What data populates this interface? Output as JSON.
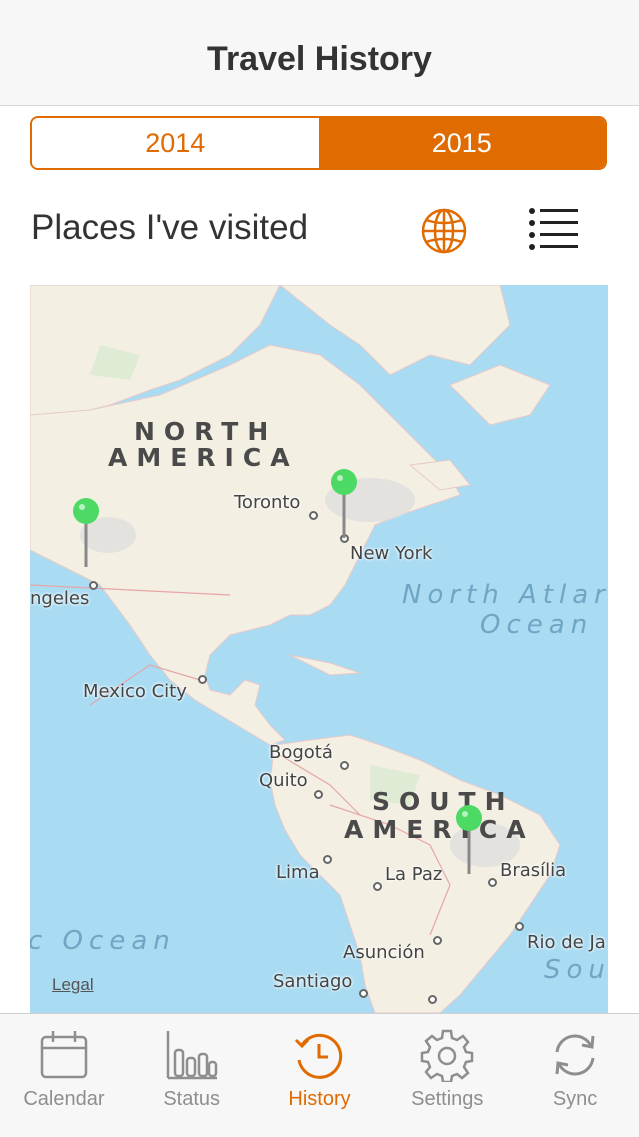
{
  "nav": {
    "title": "Travel History"
  },
  "segments": [
    {
      "label": "2014",
      "selected": false
    },
    {
      "label": "2015",
      "selected": true
    }
  ],
  "section": {
    "title": "Places I've visited",
    "globe_icon": "globe-icon",
    "list_icon": "list-icon"
  },
  "map": {
    "continents": {
      "north_america_1": "NORTH",
      "north_america_2": "AMERICA",
      "south_america_1": "SOUTH",
      "south_america_2": "AMERICA"
    },
    "oceans": {
      "north_atlantic_1": "North Atlar",
      "north_atlantic_2": "Ocean",
      "pacific": "c Ocean",
      "south_atlantic": "Sou"
    },
    "cities": {
      "toronto": "Toronto",
      "new_york": "New York",
      "los_angeles": "ngeles",
      "mexico_city": "Mexico City",
      "bogota": "Bogotá",
      "quito": "Quito",
      "lima": "Lima",
      "la_paz": "La Paz",
      "brasilia": "Brasília",
      "asuncion": "Asunción",
      "rio": "Rio de Ja",
      "santiago": "Santiago"
    },
    "legal": "Legal",
    "pin_color": "#4cd964"
  },
  "tabs": [
    {
      "label": "Calendar",
      "icon": "calendar-icon",
      "active": false
    },
    {
      "label": "Status",
      "icon": "bar-chart-icon",
      "active": false
    },
    {
      "label": "History",
      "icon": "history-icon",
      "active": true
    },
    {
      "label": "Settings",
      "icon": "gear-icon",
      "active": false
    },
    {
      "label": "Sync",
      "icon": "sync-icon",
      "active": false
    }
  ],
  "colors": {
    "accent": "#e06b00",
    "water": "#a9dbf2",
    "land": "#f4efe3"
  }
}
